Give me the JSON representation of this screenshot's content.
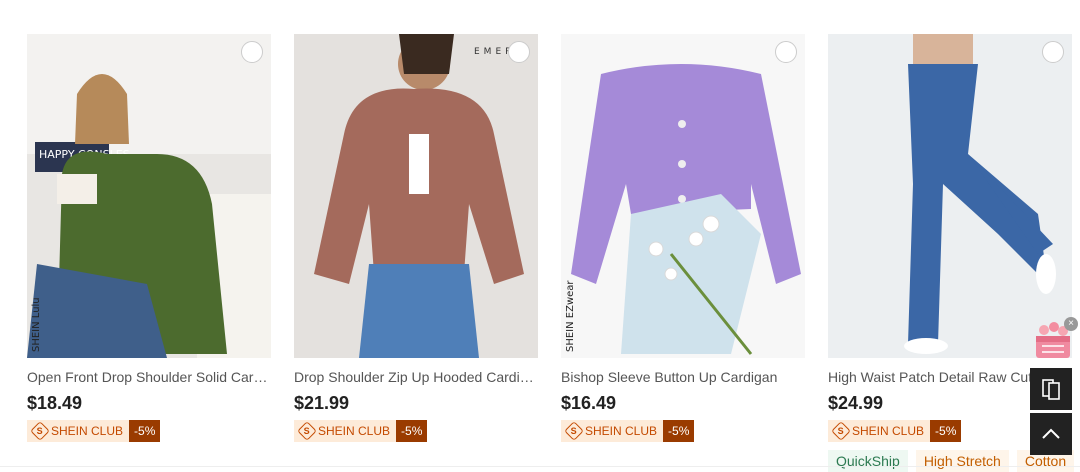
{
  "products": [
    {
      "title": "Open Front Drop Shoulder Solid Cardigan",
      "price": "$18.49",
      "club_label": "SHEIN CLUB",
      "club_discount": "-5%",
      "image_caption": "HAPPY CONSLES",
      "watermark": "SHEIN Lulu"
    },
    {
      "title": "Drop Shoulder Zip Up Hooded Cardigan",
      "price": "$21.99",
      "club_label": "SHEIN CLUB",
      "club_discount": "-5%",
      "image_caption": "EMERIS"
    },
    {
      "title": "Bishop Sleeve Button Up Cardigan",
      "price": "$16.49",
      "club_label": "SHEIN CLUB",
      "club_discount": "-5%",
      "watermark": "SHEIN EZwear"
    },
    {
      "title": "High Waist Patch Detail Raw Cut",
      "price": "$24.99",
      "club_label": "SHEIN CLUB",
      "club_discount": "-5%"
    }
  ],
  "product_tags": [
    "QuickShip",
    "High Stretch",
    "Cotton"
  ],
  "floating": {
    "close_glyph": "×"
  },
  "colors": {
    "club_text": "#c44a00",
    "club_bg": "#fdebd9",
    "club_discount_bg": "#9a3b00",
    "quickship": "#2c7a51"
  },
  "icons": [
    "select-circle-icon",
    "shein-club-icon",
    "gift-basket-icon",
    "compare-icon",
    "arrow-up-icon",
    "close-icon"
  ]
}
